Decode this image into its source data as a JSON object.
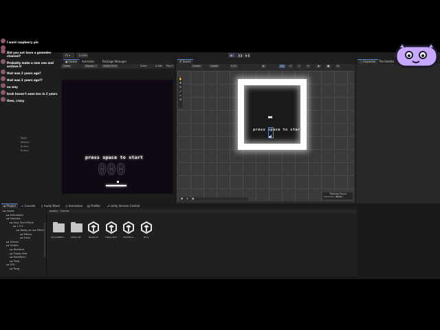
{
  "toolbar": {
    "account": "AI",
    "cloud": "Asset Store",
    "layout": "Inside",
    "play_label": "▶",
    "pause_label": "❚❚",
    "step_label": "▶❚"
  },
  "chat": {
    "messages": [
      {
        "time": "",
        "user": "",
        "text": "I want raspberry pie"
      },
      {
        "time": "",
        "user": "",
        "text": ""
      },
      {
        "time": "",
        "user": "",
        "text": "Did you not have a gamedev channel?"
      },
      {
        "time": "",
        "user": "",
        "text": "Probably make a new one and archive it"
      },
      {
        "time": "",
        "user": "",
        "text": "that was 2 years ago?"
      },
      {
        "time": "",
        "user": "",
        "text": "that was 2 years ago??"
      },
      {
        "time": "",
        "user": "",
        "text": "no way"
      },
      {
        "time": "",
        "user": "",
        "text": "bruh haven't seen bro in 2 years"
      },
      {
        "time": "",
        "user": "",
        "text": "then, crazy"
      }
    ]
  },
  "hierarchy": {
    "rows": [
      "Walls",
      "Bottom",
      "Button",
      "Button"
    ]
  },
  "game_panel": {
    "tabs": [
      "Game",
      "Animator",
      "Package Manager"
    ],
    "display": "Game",
    "display_num": "Display 1",
    "resolution": "1080x1920",
    "scale_label": "Scale",
    "scale_value": "0.48x",
    "play_focused": "Play F",
    "press_text": "press space to start",
    "score": "000"
  },
  "scene_panel": {
    "tabs": [
      "Scene"
    ],
    "center": "Center",
    "global": "Global",
    "snap": "0.25",
    "two_d": "2D",
    "press_text": "press space to start",
    "overlay_title": "Tilemap Focus",
    "focus_label": "Focus On",
    "focus_value": "None"
  },
  "inspector": {
    "tabs": [
      "Inspector",
      "Tile Palette"
    ]
  },
  "bottom": {
    "tabs": [
      "Project",
      "Console",
      "Audio Mixer",
      "Animation",
      "Profiler",
      "Unity Version Control"
    ],
    "breadcrumb_root": "Assets",
    "breadcrumb_child": "Scenes",
    "tree": [
      {
        "label": "Assets",
        "indent": 0
      },
      {
        "label": "Animations",
        "indent": 1
      },
      {
        "label": "Samples",
        "indent": 1
      },
      {
        "label": "Easy Text Effects",
        "indent": 2
      },
      {
        "label": "1.3.0",
        "indent": 3
      },
      {
        "label": "Ready-to-use Effects",
        "indent": 4
      },
      {
        "label": "Effects",
        "indent": 5
      },
      {
        "label": "Fonts",
        "indent": 5
      },
      {
        "label": "Scenes",
        "indent": 1
      },
      {
        "label": "Scripts",
        "indent": 1
      },
      {
        "label": "Breakout",
        "indent": 2
      },
      {
        "label": "Flappy Bird",
        "indent": 2
      },
      {
        "label": "MainMenu",
        "indent": 2
      },
      {
        "label": "Pong",
        "indent": 2
      },
      {
        "label": "SFX",
        "indent": 1
      },
      {
        "label": "Pong",
        "indent": 2
      }
    ],
    "assets": [
      {
        "label": "SampleEffec...",
        "kind": "folder"
      },
      {
        "label": "Utility Util",
        "kind": "folder"
      },
      {
        "label": "Breakout",
        "kind": "scene"
      },
      {
        "label": "Flappy Bird",
        "kind": "scene"
      },
      {
        "label": "MainMenu",
        "kind": "scene"
      },
      {
        "label": "Pong",
        "kind": "scene"
      }
    ]
  },
  "colors": {
    "accent": "#5a8ad6",
    "chat_name": "#c0392b",
    "logo": "#b58cff"
  }
}
